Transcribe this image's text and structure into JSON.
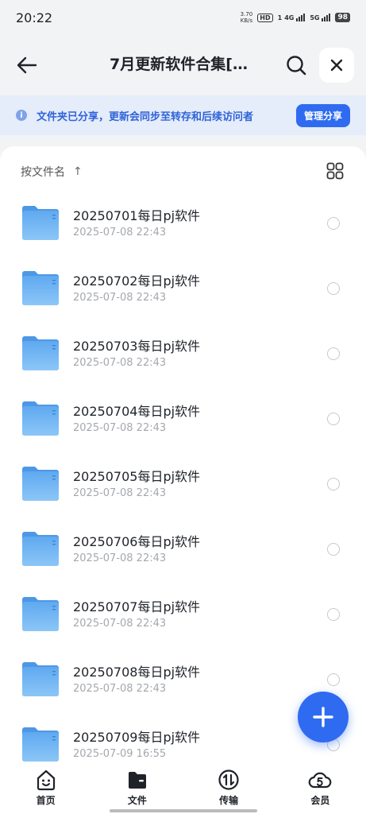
{
  "status_bar": {
    "time": "20:22",
    "speed_value": "3.70",
    "speed_unit": "KB/s",
    "hd_label": "HD",
    "sim1": "1",
    "net1": "4G",
    "net2": "5G",
    "battery": "98"
  },
  "nav": {
    "title": "7月更新软件合集[…",
    "back_icon": "arrow-left-icon",
    "search_icon": "search-icon",
    "close_icon": "close-icon"
  },
  "share_banner": {
    "info_glyph": "i",
    "text": "文件夹已分享，更新会同步至转存和后续访问者",
    "button": "管理分享"
  },
  "sort": {
    "label": "按文件名",
    "arrow": "↑",
    "view_icon": "grid-view-icon"
  },
  "files": [
    {
      "name": "20250701每日pj软件",
      "date": "2025-07-08 22:43"
    },
    {
      "name": "20250702每日pj软件",
      "date": "2025-07-08 22:43"
    },
    {
      "name": "20250703每日pj软件",
      "date": "2025-07-08 22:43"
    },
    {
      "name": "20250704每日pj软件",
      "date": "2025-07-08 22:43"
    },
    {
      "name": "20250705每日pj软件",
      "date": "2025-07-08 22:43"
    },
    {
      "name": "20250706每日pj软件",
      "date": "2025-07-08 22:43"
    },
    {
      "name": "20250707每日pj软件",
      "date": "2025-07-08 22:43"
    },
    {
      "name": "20250708每日pj软件",
      "date": "2025-07-08 22:43"
    },
    {
      "name": "20250709每日pj软件",
      "date": "2025-07-09 16:55"
    }
  ],
  "fab": {
    "icon": "plus-icon"
  },
  "tabs": [
    {
      "label": "首页",
      "icon": "home-smile-icon"
    },
    {
      "label": "文件",
      "icon": "folder-icon"
    },
    {
      "label": "传输",
      "icon": "transfer-icon"
    },
    {
      "label": "会员",
      "icon": "vip-cloud-icon"
    }
  ],
  "colors": {
    "accent": "#2f6bf0",
    "banner_bg": "#e5ecfa",
    "banner_text": "#2f63d8",
    "folder": "#6fb4f3"
  }
}
